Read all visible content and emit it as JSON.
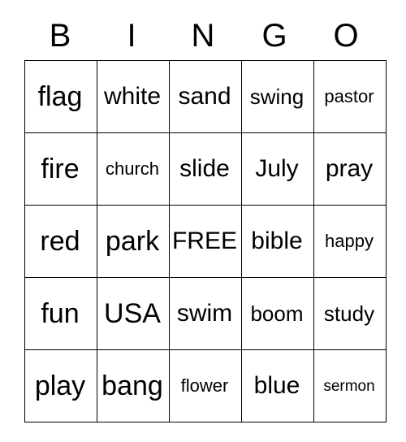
{
  "card": {
    "title_letters": [
      "B",
      "I",
      "N",
      "G",
      "O"
    ],
    "rows": [
      [
        {
          "text": "flag",
          "size": "fs-34"
        },
        {
          "text": "white",
          "size": "fs-30"
        },
        {
          "text": "sand",
          "size": "fs-30"
        },
        {
          "text": "swing",
          "size": "fs-26"
        },
        {
          "text": "pastor",
          "size": "fs-22"
        }
      ],
      [
        {
          "text": "fire",
          "size": "fs-34"
        },
        {
          "text": "church",
          "size": "fs-22"
        },
        {
          "text": "slide",
          "size": "fs-30"
        },
        {
          "text": "July",
          "size": "fs-30"
        },
        {
          "text": "pray",
          "size": "fs-30"
        }
      ],
      [
        {
          "text": "red",
          "size": "fs-34"
        },
        {
          "text": "park",
          "size": "fs-34"
        },
        {
          "text": "FREE",
          "size": "fs-30"
        },
        {
          "text": "bible",
          "size": "fs-30"
        },
        {
          "text": "happy",
          "size": "fs-22"
        }
      ],
      [
        {
          "text": "fun",
          "size": "fs-34"
        },
        {
          "text": "USA",
          "size": "fs-34"
        },
        {
          "text": "swim",
          "size": "fs-30"
        },
        {
          "text": "boom",
          "size": "fs-26"
        },
        {
          "text": "study",
          "size": "fs-26"
        }
      ],
      [
        {
          "text": "play",
          "size": "fs-34"
        },
        {
          "text": "bang",
          "size": "fs-34"
        },
        {
          "text": "flower",
          "size": "fs-22"
        },
        {
          "text": "blue",
          "size": "fs-30"
        },
        {
          "text": "sermon",
          "size": "fs-19"
        }
      ]
    ]
  }
}
